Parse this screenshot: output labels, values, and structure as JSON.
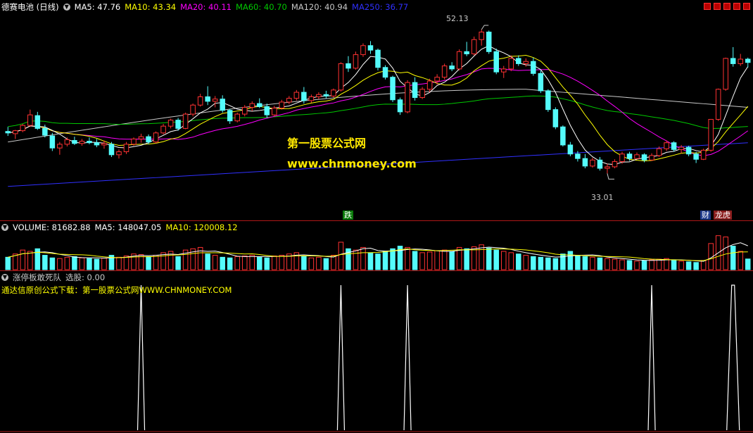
{
  "main_header": {
    "title": "德赛电池 (日线)",
    "indicators": [
      {
        "label": "MA5: 47.76",
        "color": "#ffffff"
      },
      {
        "label": "MA10: 43.34",
        "color": "#ffff00"
      },
      {
        "label": "MA20: 40.11",
        "color": "#ff00ff"
      },
      {
        "label": "MA60: 40.70",
        "color": "#00c800"
      },
      {
        "label": "MA120: 40.94",
        "color": "#c8c8c8"
      },
      {
        "label": "MA250: 36.77",
        "color": "#3030ff"
      }
    ]
  },
  "watermark": {
    "line1": "第一股票公式网",
    "line2": "www.chnmoney.com"
  },
  "price_labels": {
    "high": "52.13",
    "low": "33.01"
  },
  "event_tags": {
    "die": "跌",
    "cai": "财",
    "longhu": "龙虎"
  },
  "volume_header": {
    "title": "VOLUME: 81682.88",
    "ma5": "MA5: 148047.05",
    "ma10": "MA10: 120008.12"
  },
  "formula_header": {
    "title": "涨停板敢死队",
    "select": "选股: 0.00"
  },
  "formula_note": "通达信原创公式下载：第一股票公式网WWW.CHNMONEY.COM",
  "colors": {
    "up": "#ff3232",
    "down": "#54fcfc",
    "grid": "#b01818",
    "text_yellow": "#ffff00"
  },
  "chart_data": [
    {
      "type": "candlestick",
      "ylim": [
        28,
        54
      ],
      "candles": [
        [
          38.6,
          39.2,
          38.0,
          38.4
        ],
        [
          38.3,
          38.8,
          37.6,
          38.7
        ],
        [
          38.7,
          39.6,
          38.5,
          39.4
        ],
        [
          39.4,
          41.5,
          39.2,
          40.8
        ],
        [
          40.7,
          41.2,
          38.8,
          39.0
        ],
        [
          39.0,
          39.5,
          37.8,
          38.1
        ],
        [
          38.0,
          38.4,
          36.0,
          36.4
        ],
        [
          36.4,
          37.2,
          35.5,
          36.9
        ],
        [
          36.9,
          37.8,
          36.6,
          37.5
        ],
        [
          37.4,
          37.9,
          36.8,
          37.0
        ],
        [
          37.0,
          37.6,
          36.7,
          37.3
        ],
        [
          37.3,
          37.8,
          36.9,
          37.1
        ],
        [
          37.1,
          37.6,
          36.5,
          36.8
        ],
        [
          36.8,
          37.4,
          36.3,
          37.0
        ],
        [
          36.9,
          37.2,
          35.2,
          35.5
        ],
        [
          35.5,
          36.2,
          35.0,
          35.9
        ],
        [
          35.9,
          37.2,
          35.6,
          36.9
        ],
        [
          36.9,
          37.8,
          36.7,
          37.6
        ],
        [
          37.6,
          38.3,
          37.1,
          37.9
        ],
        [
          37.9,
          38.2,
          36.9,
          37.2
        ],
        [
          37.2,
          38.6,
          37.0,
          38.4
        ],
        [
          38.4,
          39.6,
          38.2,
          39.3
        ],
        [
          39.3,
          40.3,
          39.0,
          40.1
        ],
        [
          40.1,
          40.4,
          38.7,
          39.0
        ],
        [
          39.0,
          41.1,
          38.9,
          40.9
        ],
        [
          40.9,
          42.3,
          40.6,
          42.1
        ],
        [
          42.1,
          43.6,
          41.9,
          43.2
        ],
        [
          43.2,
          44.6,
          42.1,
          42.6
        ],
        [
          42.6,
          43.3,
          41.8,
          42.9
        ],
        [
          42.9,
          43.4,
          41.1,
          41.4
        ],
        [
          41.4,
          41.6,
          39.6,
          40.0
        ],
        [
          40.0,
          41.1,
          39.8,
          40.9
        ],
        [
          40.9,
          42.1,
          40.6,
          41.8
        ],
        [
          41.8,
          42.6,
          41.3,
          42.3
        ],
        [
          42.3,
          43.0,
          41.7,
          41.9
        ],
        [
          41.9,
          42.3,
          40.4,
          40.8
        ],
        [
          40.8,
          42.0,
          40.6,
          41.7
        ],
        [
          41.7,
          42.8,
          41.5,
          42.5
        ],
        [
          42.5,
          43.3,
          42.2,
          43.0
        ],
        [
          43.0,
          44.1,
          42.7,
          43.8
        ],
        [
          43.8,
          44.5,
          42.3,
          42.7
        ],
        [
          42.7,
          43.5,
          42.4,
          43.2
        ],
        [
          43.2,
          43.8,
          42.9,
          43.5
        ],
        [
          43.5,
          44.0,
          43.0,
          43.3
        ],
        [
          43.3,
          44.3,
          43.1,
          44.1
        ],
        [
          44.1,
          47.8,
          43.9,
          47.6
        ],
        [
          47.6,
          48.6,
          46.5,
          47.0
        ],
        [
          47.0,
          49.2,
          46.8,
          48.8
        ],
        [
          48.8,
          50.3,
          48.5,
          50.0
        ],
        [
          50.0,
          50.6,
          48.9,
          49.4
        ],
        [
          49.4,
          49.6,
          46.7,
          47.1
        ],
        [
          47.1,
          47.4,
          45.5,
          45.8
        ],
        [
          45.8,
          46.0,
          42.5,
          42.8
        ],
        [
          42.8,
          43.1,
          40.8,
          41.2
        ],
        [
          41.2,
          45.4,
          41.0,
          45.1
        ],
        [
          45.1,
          45.8,
          42.7,
          43.1
        ],
        [
          43.1,
          44.5,
          42.9,
          44.2
        ],
        [
          44.2,
          45.6,
          43.8,
          45.3
        ],
        [
          45.3,
          46.2,
          44.8,
          45.8
        ],
        [
          45.8,
          47.6,
          45.5,
          47.3
        ],
        [
          47.3,
          47.8,
          46.6,
          46.9
        ],
        [
          46.9,
          49.5,
          46.7,
          49.2
        ],
        [
          49.2,
          50.5,
          48.6,
          48.9
        ],
        [
          48.9,
          51.2,
          48.7,
          50.8
        ],
        [
          50.8,
          52.13,
          50.0,
          51.8
        ],
        [
          51.8,
          52.0,
          48.9,
          49.2
        ],
        [
          49.2,
          49.6,
          46.2,
          46.5
        ],
        [
          46.5,
          47.3,
          45.7,
          46.9
        ],
        [
          46.9,
          48.7,
          46.6,
          48.3
        ],
        [
          48.3,
          48.7,
          47.3,
          47.6
        ],
        [
          47.6,
          48.3,
          47.2,
          47.9
        ],
        [
          47.9,
          48.4,
          46.0,
          46.3
        ],
        [
          46.3,
          46.7,
          43.7,
          44.0
        ],
        [
          44.0,
          44.2,
          41.2,
          41.5
        ],
        [
          41.5,
          41.8,
          38.9,
          39.2
        ],
        [
          39.2,
          39.4,
          36.6,
          36.8
        ],
        [
          36.8,
          37.2,
          35.3,
          35.6
        ],
        [
          35.6,
          36.0,
          34.6,
          35.0
        ],
        [
          35.0,
          35.6,
          33.7,
          34.0
        ],
        [
          34.0,
          35.1,
          33.8,
          34.8
        ],
        [
          34.8,
          35.2,
          33.4,
          33.7
        ],
        [
          33.7,
          34.3,
          33.01,
          33.9
        ],
        [
          33.9,
          34.9,
          33.7,
          34.6
        ],
        [
          34.6,
          35.9,
          34.3,
          35.6
        ],
        [
          35.6,
          35.9,
          34.7,
          35.0
        ],
        [
          35.0,
          35.8,
          34.9,
          35.5
        ],
        [
          35.5,
          35.7,
          34.5,
          34.8
        ],
        [
          34.8,
          35.7,
          34.7,
          35.4
        ],
        [
          35.4,
          36.6,
          35.2,
          36.3
        ],
        [
          36.3,
          37.4,
          36.0,
          37.1
        ],
        [
          37.1,
          37.3,
          35.9,
          36.2
        ],
        [
          36.2,
          36.8,
          35.7,
          36.5
        ],
        [
          36.5,
          36.7,
          35.3,
          35.6
        ],
        [
          35.6,
          35.9,
          34.4,
          34.9
        ],
        [
          34.9,
          36.3,
          34.8,
          36.1
        ],
        [
          36.1,
          37.4,
          35.9,
          40.2
        ],
        [
          40.2,
          44.3,
          40.0,
          44.2
        ],
        [
          44.2,
          48.4,
          44.0,
          48.3
        ],
        [
          48.3,
          49.8,
          47.2,
          47.6
        ],
        [
          47.6,
          48.9,
          47.3,
          48.2
        ],
        [
          48.2,
          48.4,
          47.1,
          47.76
        ]
      ],
      "ma5_last": 47.76,
      "ma10_last": 43.34,
      "ma20_last": 40.11,
      "ma60_last": 40.7,
      "ma120_last": 40.94,
      "ma250_last": 36.77,
      "high_label": 52.13,
      "low_label": 33.01
    },
    {
      "type": "bar",
      "series_name": "VOLUME",
      "values": [
        95,
        120,
        150,
        140,
        160,
        110,
        90,
        85,
        95,
        100,
        90,
        85,
        80,
        88,
        110,
        95,
        105,
        120,
        115,
        100,
        110,
        130,
        140,
        100,
        150,
        160,
        170,
        120,
        110,
        95,
        90,
        100,
        105,
        110,
        95,
        90,
        105,
        110,
        120,
        130,
        100,
        90,
        95,
        85,
        110,
        210,
        160,
        150,
        170,
        130,
        120,
        140,
        160,
        180,
        170,
        140,
        130,
        135,
        145,
        150,
        140,
        170,
        160,
        175,
        190,
        165,
        150,
        140,
        130,
        120,
        110,
        100,
        95,
        90,
        85,
        120,
        140,
        110,
        100,
        95,
        90,
        85,
        80,
        75,
        70,
        65,
        70,
        75,
        80,
        85,
        70,
        65,
        60,
        55,
        70,
        200,
        260,
        250,
        180,
        140,
        81.68
      ],
      "ma5_last": 148047.05,
      "ma10_last": 120008.12
    },
    {
      "type": "line",
      "series_name": "涨停板敢死队",
      "spikes_at": [
        18,
        45,
        54,
        87,
        98
      ],
      "select_last": 0.0
    }
  ]
}
